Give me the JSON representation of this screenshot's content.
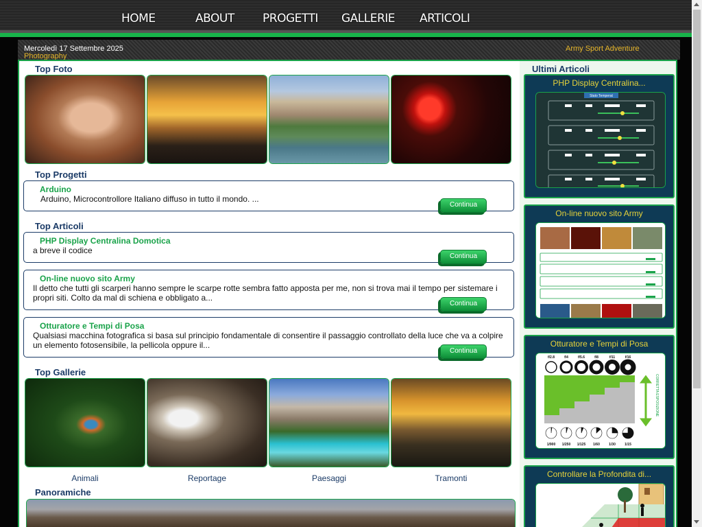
{
  "nav": {
    "items": [
      "HOME",
      "ABOUT",
      "PROGETTI",
      "GALLERIE",
      "ARTICOLI"
    ]
  },
  "infobar": {
    "date": "Mercoledì 17 Settembre 2025",
    "photography": "Photography",
    "brand": "Army Sport Adventure"
  },
  "sections": {
    "top_foto": "Top Foto",
    "top_progetti": "Top Progetti",
    "top_articoli": "Top Articoli",
    "top_gallerie": "Top Gallerie",
    "panoramiche": "Panoramiche"
  },
  "projects": [
    {
      "title": "Arduino",
      "text": "Arduino, Microcontrollore Italiano diffuso in tutto il mondo. ...",
      "button": "Continua"
    }
  ],
  "articles": [
    {
      "title": "PHP Display Centralina Domotica",
      "text": "a breve il codice",
      "button": "Continua"
    },
    {
      "title": "On-line nuovo sito Army",
      "text": "Il detto che  tutti gli scarperi hanno sempre le scarpe rotte sembra fatto apposta per me, non si trova mai il tempo per sistemare i propri siti. Colto da mal di schiena e obbligato a...",
      "button": "Continua"
    },
    {
      "title": "Otturatore e Tempi di Posa",
      "text": "Qualsiasi macchina fotografica si basa sul principio fondamentale di consentire il passaggio controllato della luce che va a colpire un elemento fotosensibile, la pellicola oppure il...",
      "button": "Continua"
    }
  ],
  "galleries": [
    "Animali",
    "Reportage",
    "Paesaggi",
    "Tramonti"
  ],
  "sidebar": {
    "title": "Ultimi Articoli",
    "items": [
      "PHP Display Centralina...",
      "On-line nuovo sito Army",
      "Otturatore e Tempi di Posa",
      "Controllare la Profondita di..."
    ]
  },
  "diagram": {
    "panel_title": "Stato Temperat",
    "apertures": [
      "f/2.8",
      "f/4",
      "f/5.6",
      "f/8",
      "f/11",
      "f/16"
    ],
    "shutter": [
      "1/900",
      "1/250",
      "1/125",
      "1/60",
      "1/30",
      "1/15"
    ],
    "exposure_label": "CORRETTA ESPOSIZIONE"
  },
  "colors": {
    "accent_green": "#1aa34a",
    "navy": "#1a3a66",
    "gold": "#e6b62a"
  }
}
